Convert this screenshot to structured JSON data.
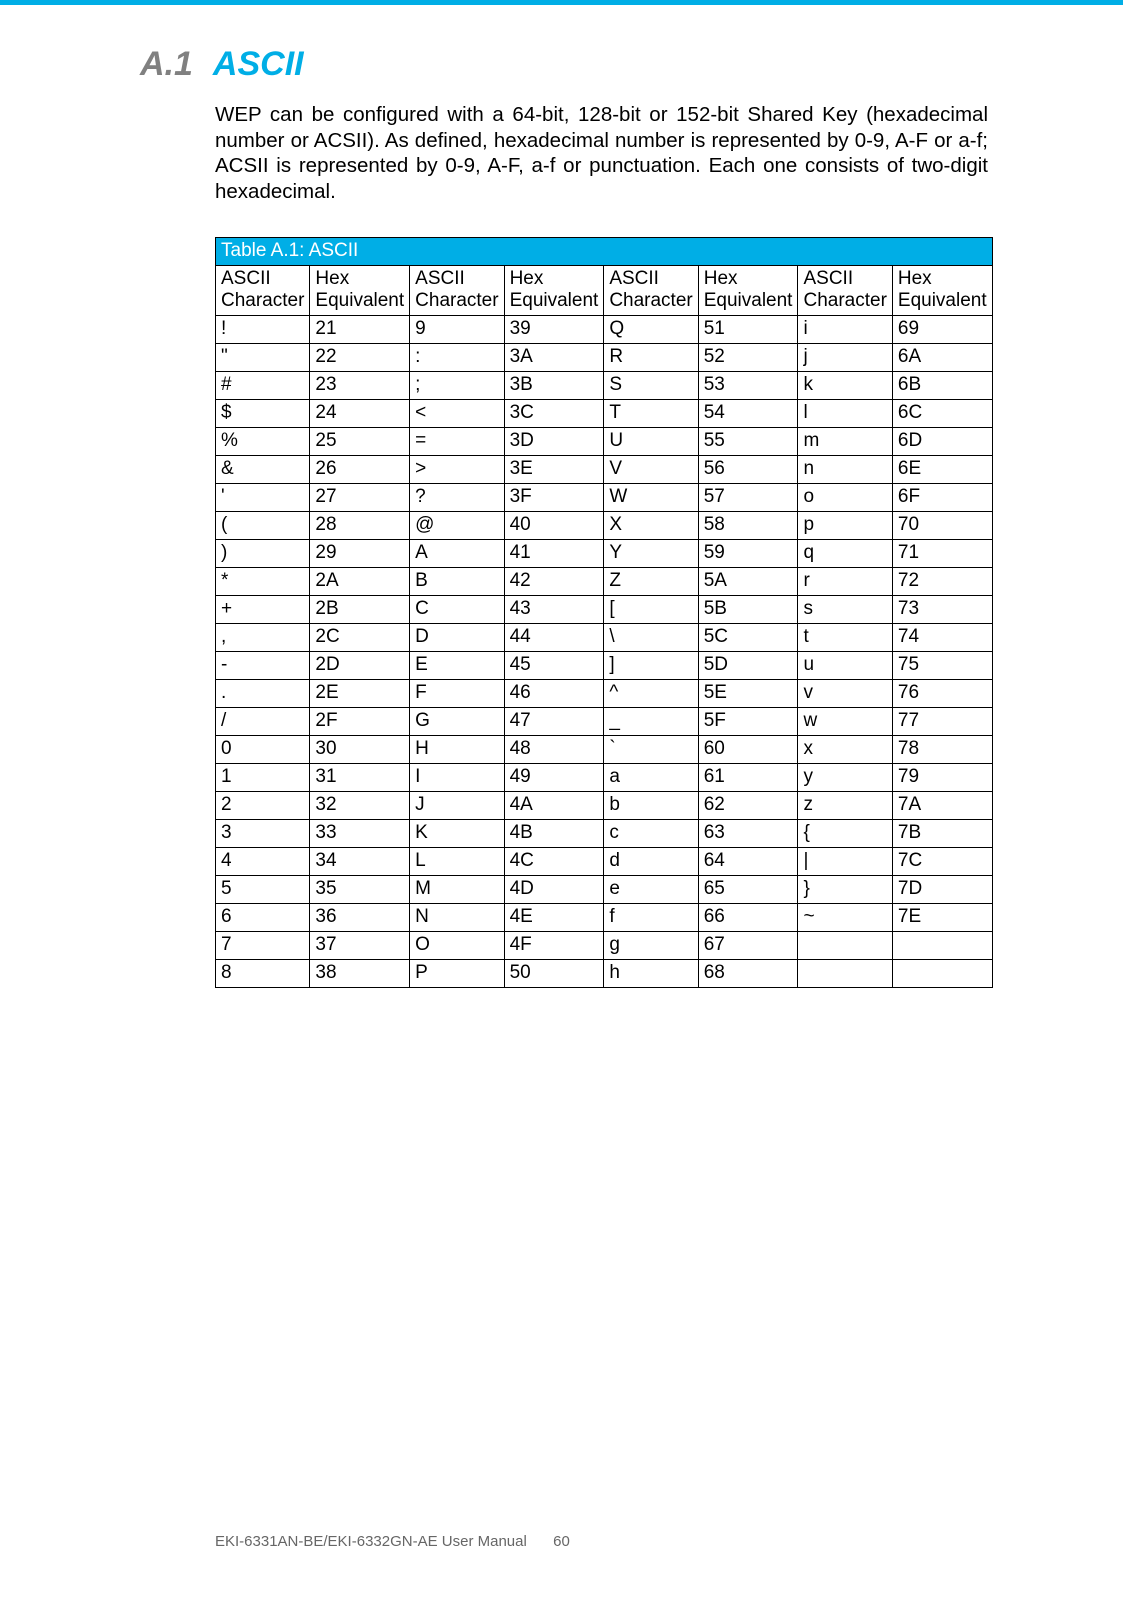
{
  "section": {
    "number": "A.1",
    "title": "ASCII",
    "intro": "WEP can be configured with a 64-bit, 128-bit or 152-bit Shared Key (hexadecimal number or ACSII). As defined, hexadecimal number is represented by 0-9, A-F or a-f; ACSII is represented by 0-9, A-F, a-f or punctuation. Each one consists of two-digit hexadecimal."
  },
  "table": {
    "caption": "Table A.1: ASCII",
    "headers": [
      "ASCII Character",
      "Hex Equivalent",
      "ASCII Character",
      "Hex Equivalent",
      "ASCII Character",
      "Hex Equivalent",
      "ASCII Character",
      "Hex Equivalent"
    ],
    "rows": [
      [
        "!",
        "21",
        "9",
        "39",
        "Q",
        "51",
        "i",
        "69"
      ],
      [
        "\"",
        "22",
        ":",
        "3A",
        "R",
        "52",
        "j",
        "6A"
      ],
      [
        "#",
        "23",
        ";",
        "3B",
        "S",
        "53",
        "k",
        "6B"
      ],
      [
        "$",
        "24",
        "<",
        "3C",
        "T",
        "54",
        "l",
        "6C"
      ],
      [
        "%",
        "25",
        "=",
        "3D",
        "U",
        "55",
        "m",
        "6D"
      ],
      [
        "&",
        "26",
        ">",
        "3E",
        "V",
        "56",
        "n",
        "6E"
      ],
      [
        "'",
        "27",
        "?",
        "3F",
        "W",
        "57",
        "o",
        "6F"
      ],
      [
        "(",
        "28",
        "@",
        "40",
        "X",
        "58",
        "p",
        "70"
      ],
      [
        ")",
        "29",
        "A",
        "41",
        "Y",
        "59",
        "q",
        "71"
      ],
      [
        "*",
        "2A",
        "B",
        "42",
        "Z",
        "5A",
        "r",
        "72"
      ],
      [
        "+",
        "2B",
        "C",
        "43",
        "[",
        "5B",
        "s",
        "73"
      ],
      [
        ",",
        "2C",
        "D",
        "44",
        "\\",
        "5C",
        "t",
        "74"
      ],
      [
        "-",
        "2D",
        "E",
        "45",
        "]",
        "5D",
        "u",
        "75"
      ],
      [
        ".",
        "2E",
        "F",
        "46",
        "^",
        "5E",
        "v",
        "76"
      ],
      [
        "/",
        "2F",
        "G",
        "47",
        "_",
        "5F",
        "w",
        "77"
      ],
      [
        "0",
        "30",
        "H",
        "48",
        "`",
        "60",
        "x",
        "78"
      ],
      [
        "1",
        "31",
        "I",
        "49",
        "a",
        "61",
        "y",
        "79"
      ],
      [
        "2",
        "32",
        "J",
        "4A",
        "b",
        "62",
        "z",
        "7A"
      ],
      [
        "3",
        "33",
        "K",
        "4B",
        "c",
        "63",
        "{",
        "7B"
      ],
      [
        "4",
        "34",
        "L",
        "4C",
        "d",
        "64",
        "|",
        "7C"
      ],
      [
        "5",
        "35",
        "M",
        "4D",
        "e",
        "65",
        "}",
        "7D"
      ],
      [
        "6",
        "36",
        "N",
        "4E",
        "f",
        "66",
        "~",
        "7E"
      ],
      [
        "7",
        "37",
        "O",
        "4F",
        "g",
        "67",
        "",
        ""
      ],
      [
        "8",
        "38",
        "P",
        "50",
        "h",
        "68",
        "",
        ""
      ]
    ]
  },
  "footer": {
    "manual": "EKI-6331AN-BE/EKI-6332GN-AE User Manual",
    "page": "60"
  }
}
